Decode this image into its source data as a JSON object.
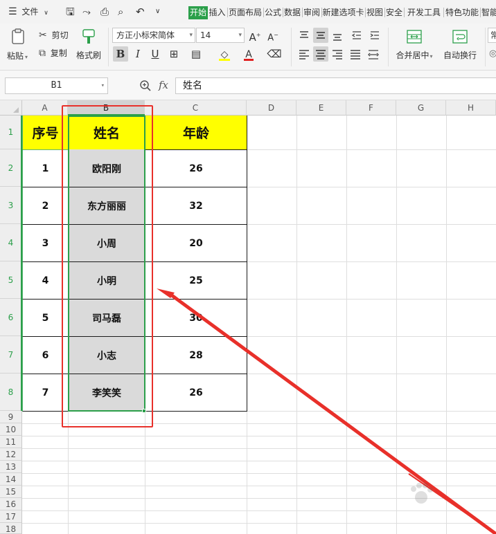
{
  "menubar": {
    "file_menu": "文件",
    "tabs": [
      "开始",
      "插入",
      "页面布局",
      "公式",
      "数据",
      "审阅",
      "新建选项卡",
      "视图",
      "安全",
      "开发工具",
      "特色功能",
      "智能"
    ],
    "active_tab": "开始"
  },
  "ribbon": {
    "paste": "粘贴",
    "cut": "剪切",
    "copy": "复制",
    "format_painter": "格式刷",
    "font_name": "方正小标宋简体",
    "font_size": "14",
    "merge_center": "合并居中",
    "wrap_text": "自动换行",
    "number_format_partial": "常"
  },
  "formula_bar": {
    "name_box": "B1",
    "fx": "fx",
    "content": "姓名"
  },
  "sheet": {
    "columns": [
      "A",
      "B",
      "C",
      "D",
      "E",
      "F",
      "G",
      "H"
    ],
    "rows": [
      "1",
      "2",
      "3",
      "4",
      "5",
      "6",
      "7",
      "8",
      "9",
      "10",
      "11",
      "12",
      "13",
      "14",
      "15",
      "16",
      "17",
      "18"
    ],
    "selected_column": "B",
    "table": {
      "header": [
        "序号",
        "姓名",
        "年龄"
      ],
      "rows": [
        [
          "1",
          "欧阳刚",
          "26"
        ],
        [
          "2",
          "东方丽丽",
          "32"
        ],
        [
          "3",
          "小周",
          "20"
        ],
        [
          "4",
          "小明",
          "25"
        ],
        [
          "5",
          "司马磊",
          "30"
        ],
        [
          "6",
          "小志",
          "28"
        ],
        [
          "7",
          "李笑笑",
          "26"
        ]
      ]
    }
  },
  "colors": {
    "header_fill": "#ffff00",
    "selection_green": "#2b9f4a",
    "annotation_red": "#e8302a",
    "active_tab": "#2b9f4a"
  }
}
